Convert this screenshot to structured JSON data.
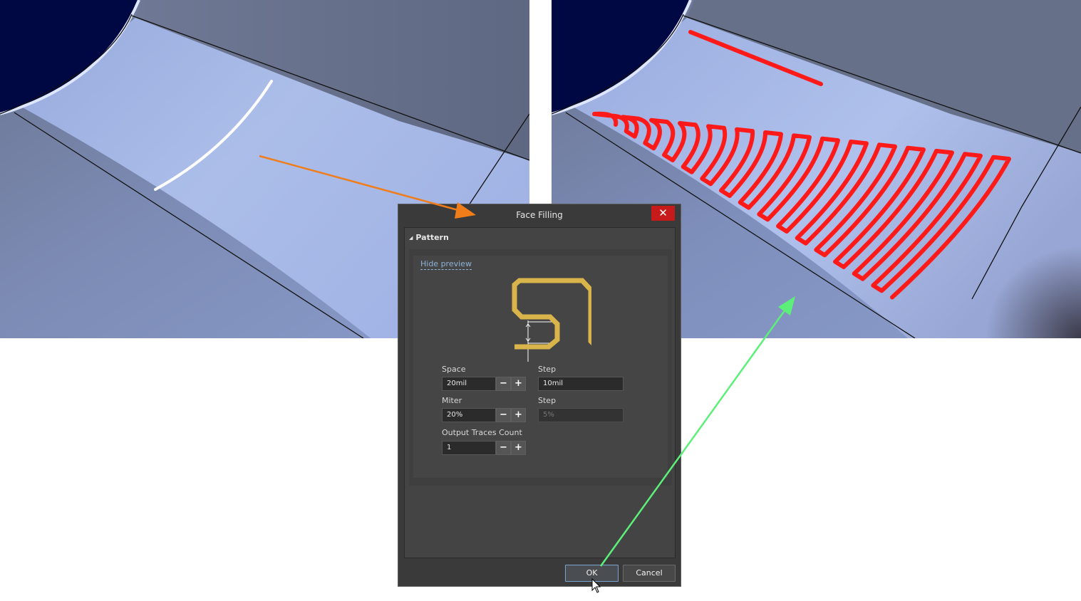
{
  "dialog": {
    "title": "Face Filling",
    "close_glyph": "✕",
    "section": {
      "label": "Pattern",
      "collapse_glyph": "◢"
    },
    "hide_preview_label": "Hide preview",
    "fields": {
      "space": {
        "label": "Space",
        "value": "20mil",
        "minus": "−",
        "plus": "+"
      },
      "space_step": {
        "label": "Step",
        "value": "10mil"
      },
      "miter": {
        "label": "Miter",
        "value": "20%",
        "minus": "−",
        "plus": "+"
      },
      "miter_step": {
        "label": "Step",
        "value": "5%"
      },
      "output_traces": {
        "label": "Output Traces Count",
        "value": "1",
        "minus": "−",
        "plus": "+"
      }
    },
    "buttons": {
      "ok": "OK",
      "cancel": "Cancel"
    }
  },
  "colors": {
    "viewport_background": "#000844",
    "surface": "#8a9ccc",
    "surface_highlight": "#b4c6f2",
    "trace_original": "#ffffff",
    "trace_filled": "#ff1a1a",
    "preview_trace": "#d9b44a",
    "arrow_orange": "#f07d1a",
    "arrow_green": "#5cf07a",
    "close_button": "#c71b1b"
  },
  "icons": [
    "close-icon",
    "collapse-triangle-icon",
    "minus-icon",
    "plus-icon",
    "mouse-cursor-icon"
  ]
}
